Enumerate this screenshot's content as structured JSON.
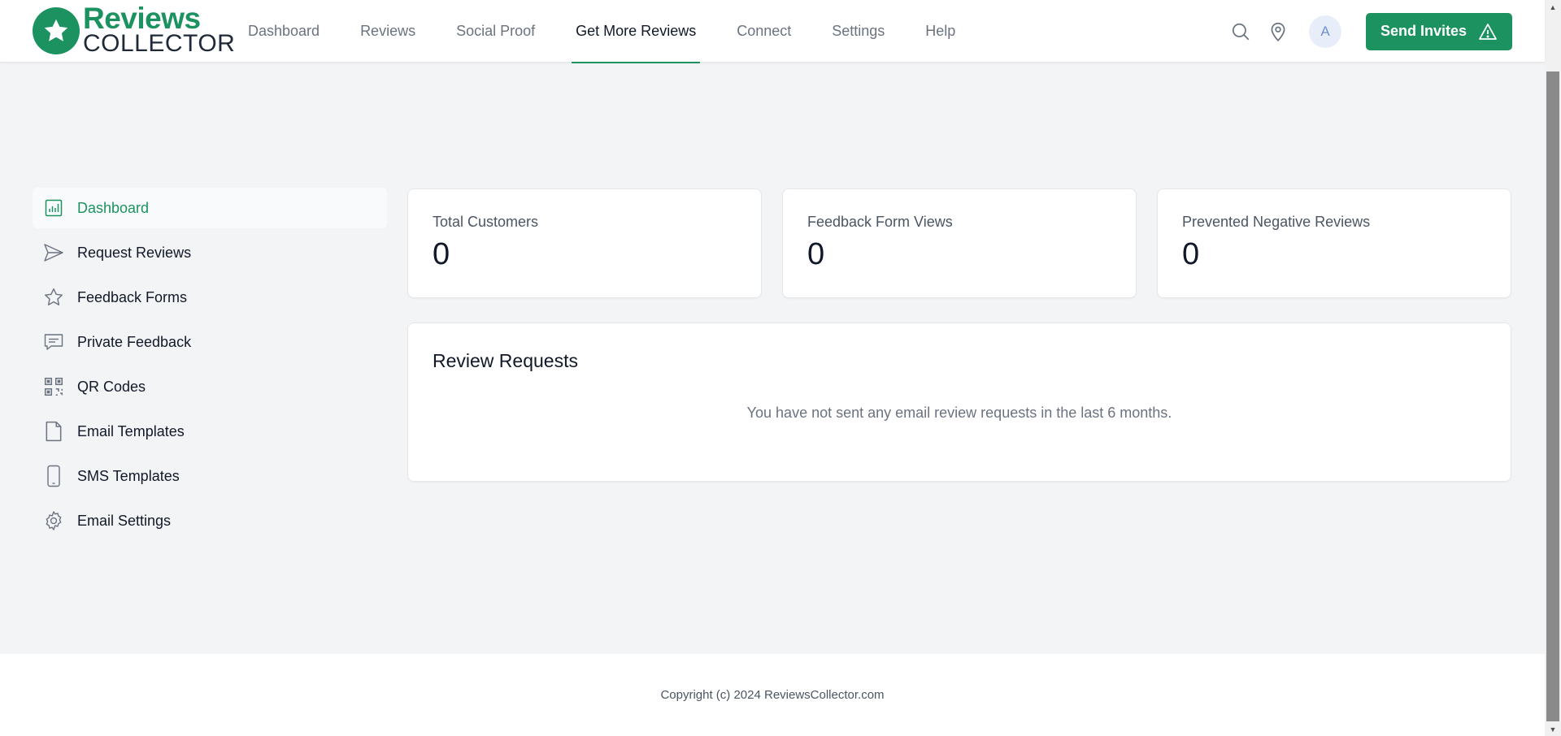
{
  "brand": {
    "logo_line1": "Reviews",
    "logo_line2": "COLLECTOR",
    "primary_color": "#1b9260"
  },
  "nav": {
    "items": [
      {
        "label": "Dashboard",
        "active": false
      },
      {
        "label": "Reviews",
        "active": false
      },
      {
        "label": "Social Proof",
        "active": false
      },
      {
        "label": "Get More Reviews",
        "active": true
      },
      {
        "label": "Connect",
        "active": false
      },
      {
        "label": "Settings",
        "active": false
      },
      {
        "label": "Help",
        "active": false
      }
    ]
  },
  "header": {
    "search_icon": "search-icon",
    "location_icon": "map-pin-icon",
    "avatar_initial": "A",
    "send_button_label": "Send Invites",
    "send_button_icon": "warning-triangle-icon"
  },
  "sidebar": {
    "items": [
      {
        "label": "Dashboard",
        "icon": "bar-chart-icon",
        "active": true
      },
      {
        "label": "Request Reviews",
        "icon": "send-icon",
        "active": false
      },
      {
        "label": "Feedback Forms",
        "icon": "star-icon",
        "active": false
      },
      {
        "label": "Private Feedback",
        "icon": "chat-bubble-icon",
        "active": false
      },
      {
        "label": "QR Codes",
        "icon": "qr-code-icon",
        "active": false
      },
      {
        "label": "Email Templates",
        "icon": "document-icon",
        "active": false
      },
      {
        "label": "SMS Templates",
        "icon": "phone-icon",
        "active": false
      },
      {
        "label": "Email Settings",
        "icon": "gear-icon",
        "active": false
      }
    ]
  },
  "stats": [
    {
      "label": "Total Customers",
      "value": "0"
    },
    {
      "label": "Feedback Form Views",
      "value": "0"
    },
    {
      "label": "Prevented Negative Reviews",
      "value": "0"
    }
  ],
  "review_requests": {
    "title": "Review Requests",
    "empty_message": "You have not sent any email review requests in the last 6 months."
  },
  "footer": {
    "copyright": "Copyright (c) 2024 ReviewsCollector.com"
  }
}
